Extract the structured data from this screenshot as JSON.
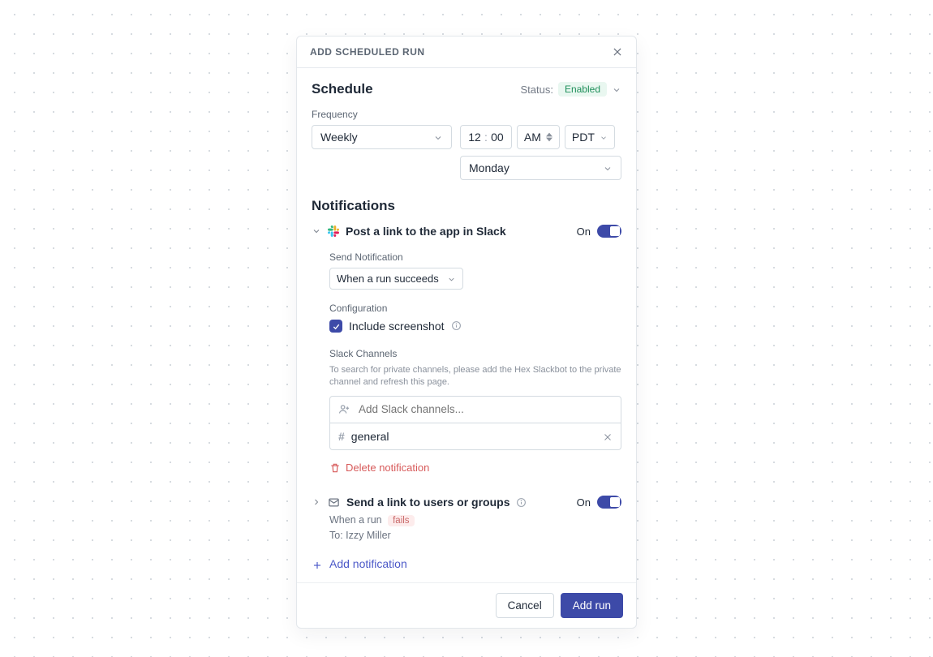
{
  "dialog": {
    "title": "ADD SCHEDULED RUN"
  },
  "schedule": {
    "heading": "Schedule",
    "status_label": "Status:",
    "status_value": "Enabled",
    "frequency_label": "Frequency",
    "frequency_value": "Weekly",
    "time_hour": "12",
    "time_minute": "00",
    "ampm": "AM",
    "tz": "PDT",
    "day_value": "Monday"
  },
  "notifications": {
    "heading": "Notifications",
    "slack": {
      "title": "Post a link to the app in Slack",
      "toggle_label": "On",
      "send_label": "Send Notification",
      "send_value": "When a run succeeds",
      "config_label": "Configuration",
      "include_screenshot_label": "Include screenshot",
      "channels_label": "Slack Channels",
      "channels_hint": "To search for private channels, please add the Hex Slackbot to the private channel and refresh this page.",
      "channels_placeholder": "Add Slack channels...",
      "channel_name": "general",
      "delete_label": "Delete notification"
    },
    "email": {
      "title": "Send a link to users or groups",
      "toggle_label": "On",
      "when_prefix": "When a run",
      "when_value": "fails",
      "to_line": "To: Izzy Miller"
    },
    "add_label": "Add notification"
  },
  "footer": {
    "cancel": "Cancel",
    "submit": "Add run"
  },
  "icons": {
    "close": "close-icon",
    "chevron_down": "chevron-down-icon",
    "chevron_right": "chevron-right-icon",
    "slack": "slack-icon",
    "info": "info-icon",
    "mail": "mail-icon",
    "trash": "trash-icon",
    "plus": "plus-icon",
    "person_add": "person-add-icon",
    "hash": "hash-icon",
    "check": "check-icon",
    "updown": "up-down-icon"
  },
  "colors": {
    "accent": "#3d4aa8",
    "status_bg": "#e9f7f0",
    "status_fg": "#1f8f5a",
    "danger": "#d75a5a",
    "border": "#d4dbe1",
    "text": "#1f2937",
    "muted": "#6b7380"
  }
}
